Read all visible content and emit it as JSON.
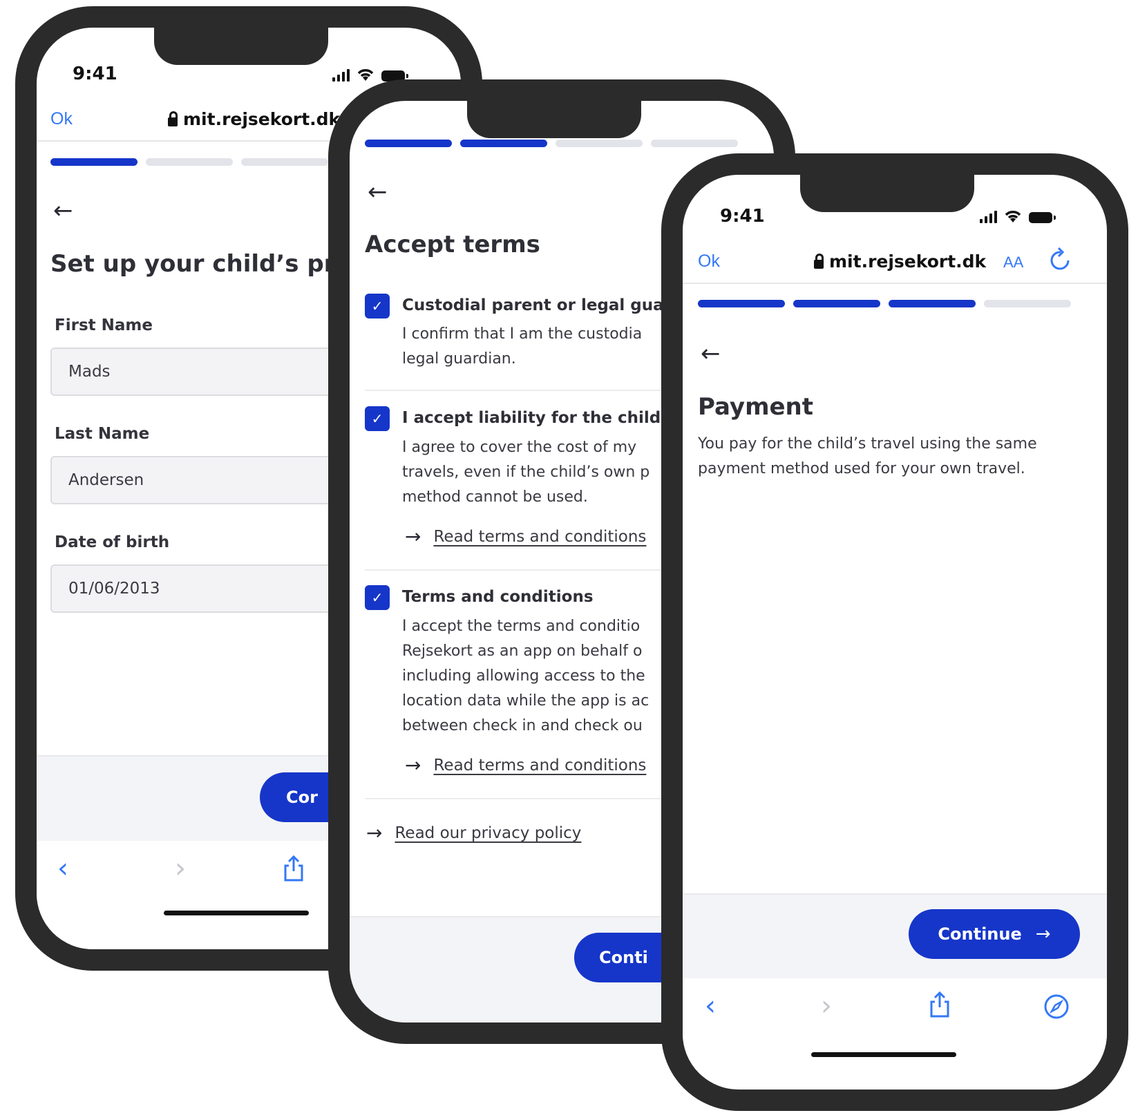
{
  "status_bar": {
    "time": "9:41"
  },
  "browser": {
    "done_label": "Ok",
    "url": "mit.rejsekort.dk",
    "text_size_label": "AA"
  },
  "screen1": {
    "title": "Set up your child’s pro",
    "fields": [
      {
        "label": "First Name",
        "value": "Mads"
      },
      {
        "label": "Last Name",
        "value": "Andersen"
      },
      {
        "label": "Date of birth",
        "value": "01/06/2013"
      }
    ],
    "continue_label": "Cor"
  },
  "screen2": {
    "title": "Accept terms",
    "terms": [
      {
        "title": "Custodial parent or legal guar",
        "lines": [
          "I confirm that I am the custodia",
          "legal guardian."
        ]
      },
      {
        "title": "I accept liability for the child's",
        "lines": [
          "I agree to cover the cost of my",
          "travels, even if the child’s own p",
          "method cannot be used."
        ],
        "link": "Read terms and conditions"
      },
      {
        "title": "Terms and conditions",
        "lines": [
          "I accept the terms and conditio",
          "Rejsekort as an app on behalf o",
          "including allowing access to the",
          "location data while the app is ac",
          "between check in and check ou"
        ],
        "link": "Read terms and conditions"
      }
    ],
    "privacy_link": "Read our privacy policy",
    "continue_label": "Conti"
  },
  "screen3": {
    "title": "Payment",
    "body_lines": [
      "You pay for the child’s travel using the same",
      "payment method used for your own travel."
    ],
    "continue_label": "Continue"
  },
  "progress": {
    "screen1_filled": 1,
    "screen2_filled": 2,
    "screen3_filled": 3,
    "total": 4
  },
  "colors": {
    "accent": "#1636c9",
    "ios_blue": "#3478f6",
    "frame": "#2b2b2b"
  }
}
